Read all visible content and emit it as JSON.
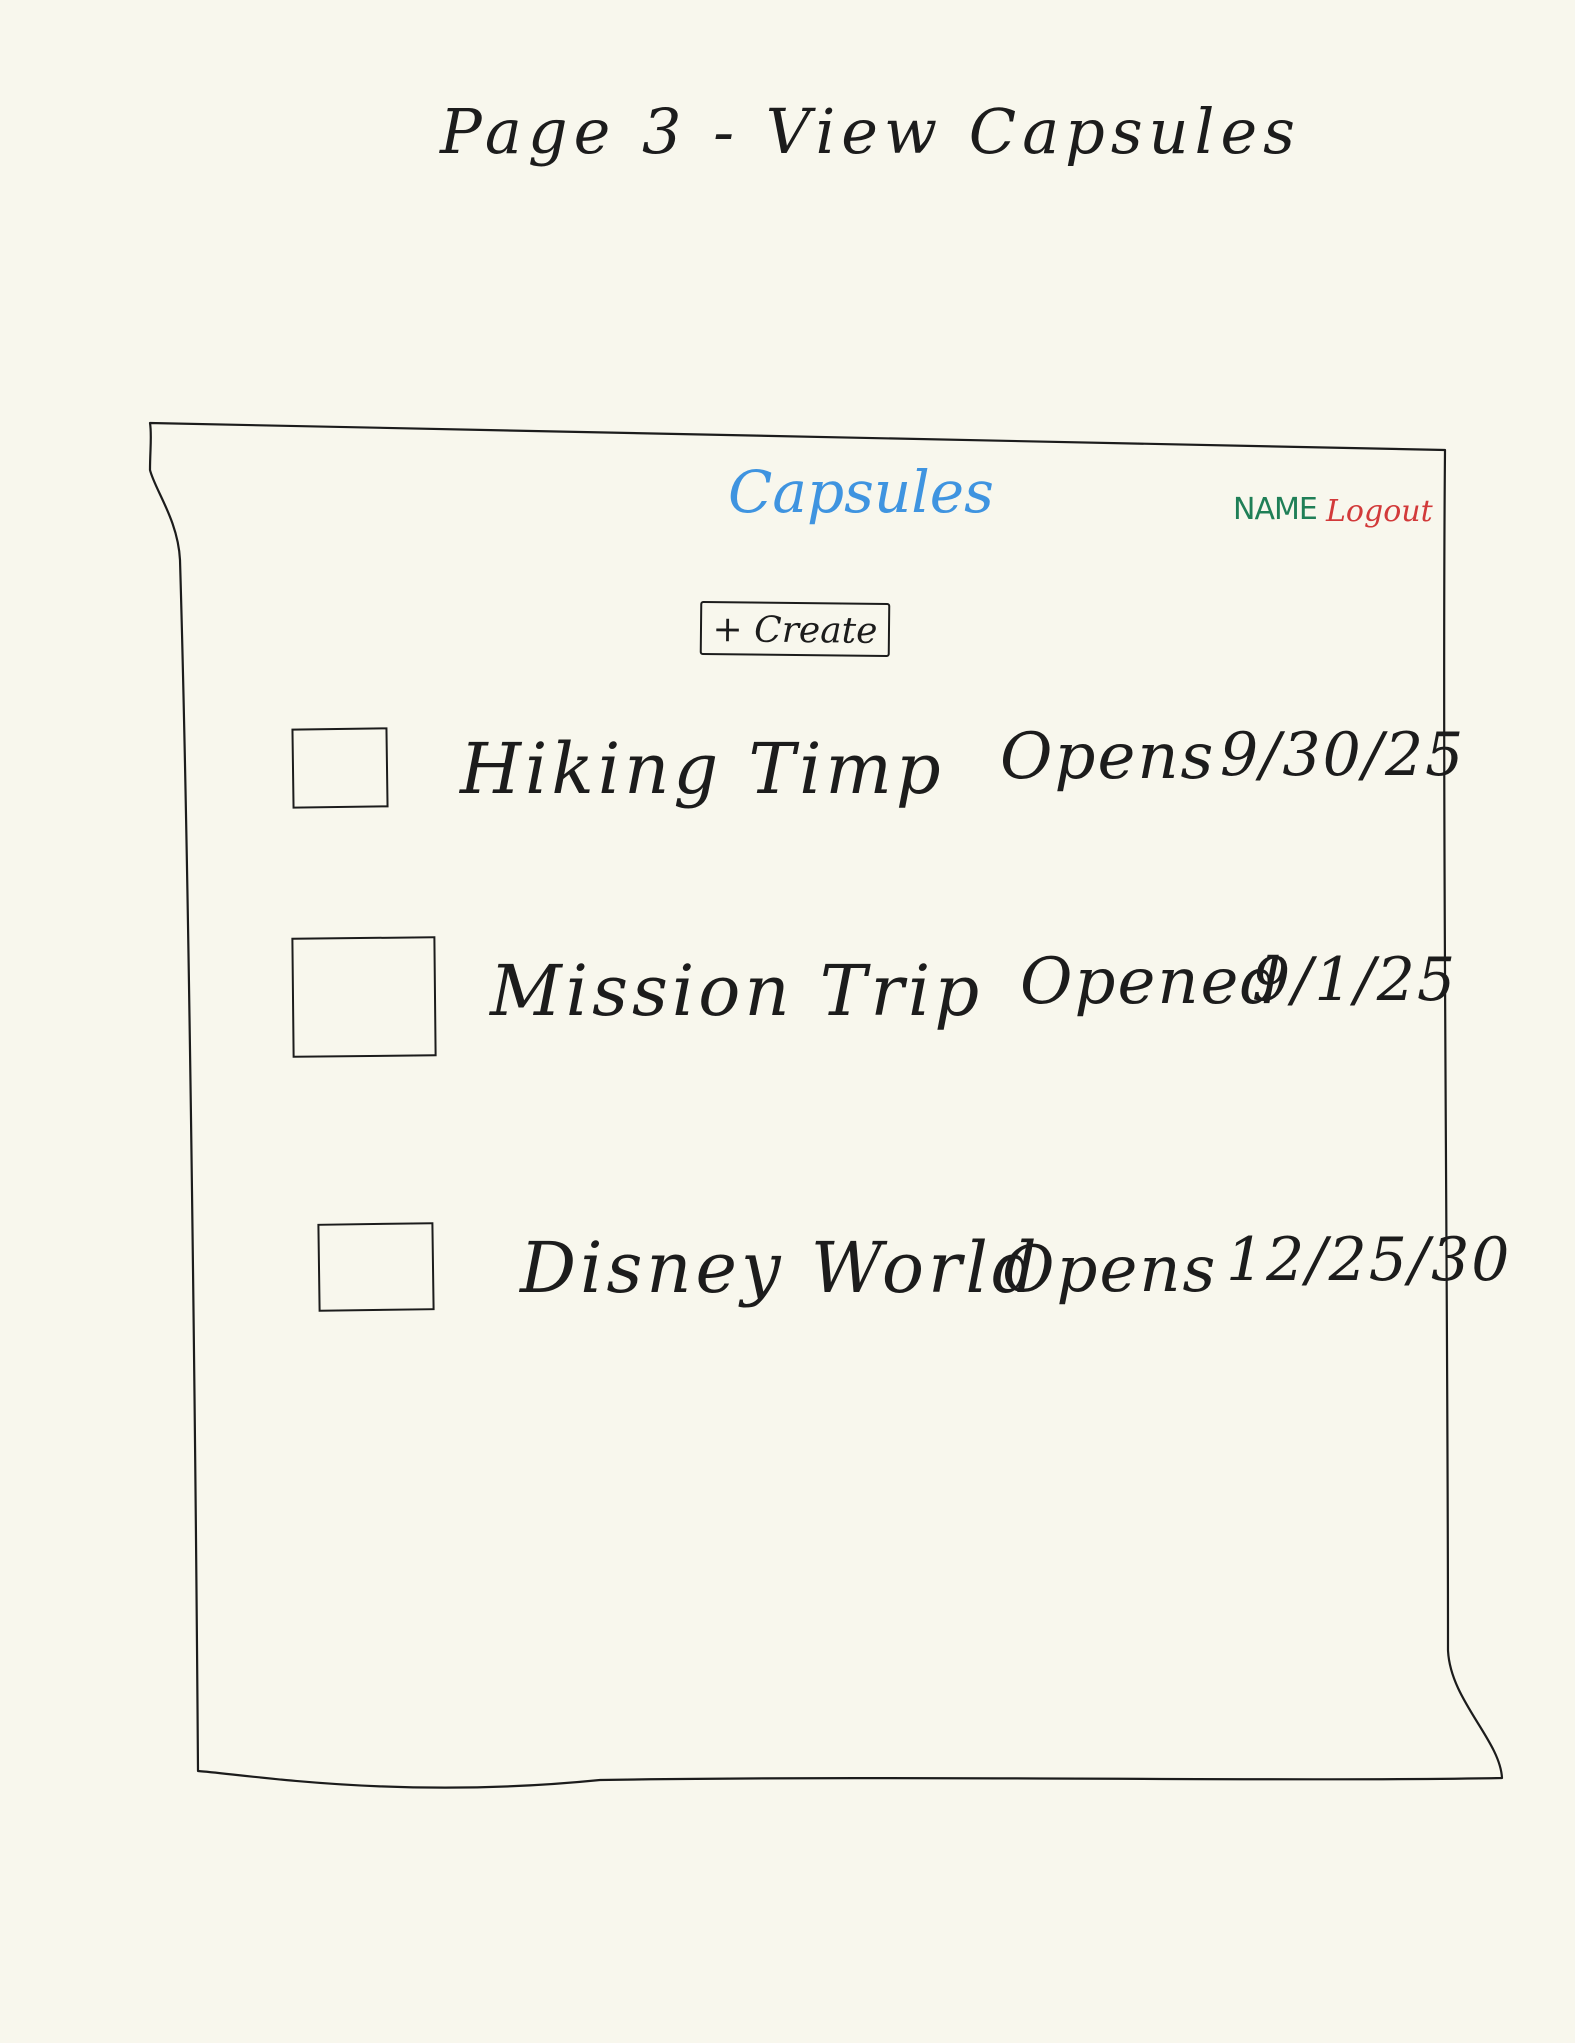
{
  "page": {
    "title": "Page 3 - View Capsules"
  },
  "header": {
    "app_title": "Capsules",
    "user_name": "NAME",
    "logout_label": "Logout"
  },
  "toolbar": {
    "create_label": "+ Create"
  },
  "capsules": [
    {
      "name": "Hiking Timp",
      "status": "Opens",
      "date": "9/30/25",
      "checked": false
    },
    {
      "name": "Mission Trip",
      "status": "Opened",
      "date": "9/1/25",
      "checked": false
    },
    {
      "name": "Disney World",
      "status": "Opens",
      "date": "12/25/30",
      "checked": false
    }
  ],
  "colors": {
    "background": "#f8f7ed",
    "ink": "#1c1c1c",
    "app_title": "#3f94e0",
    "user_name": "#1f7f57",
    "logout": "#d23a3a"
  }
}
